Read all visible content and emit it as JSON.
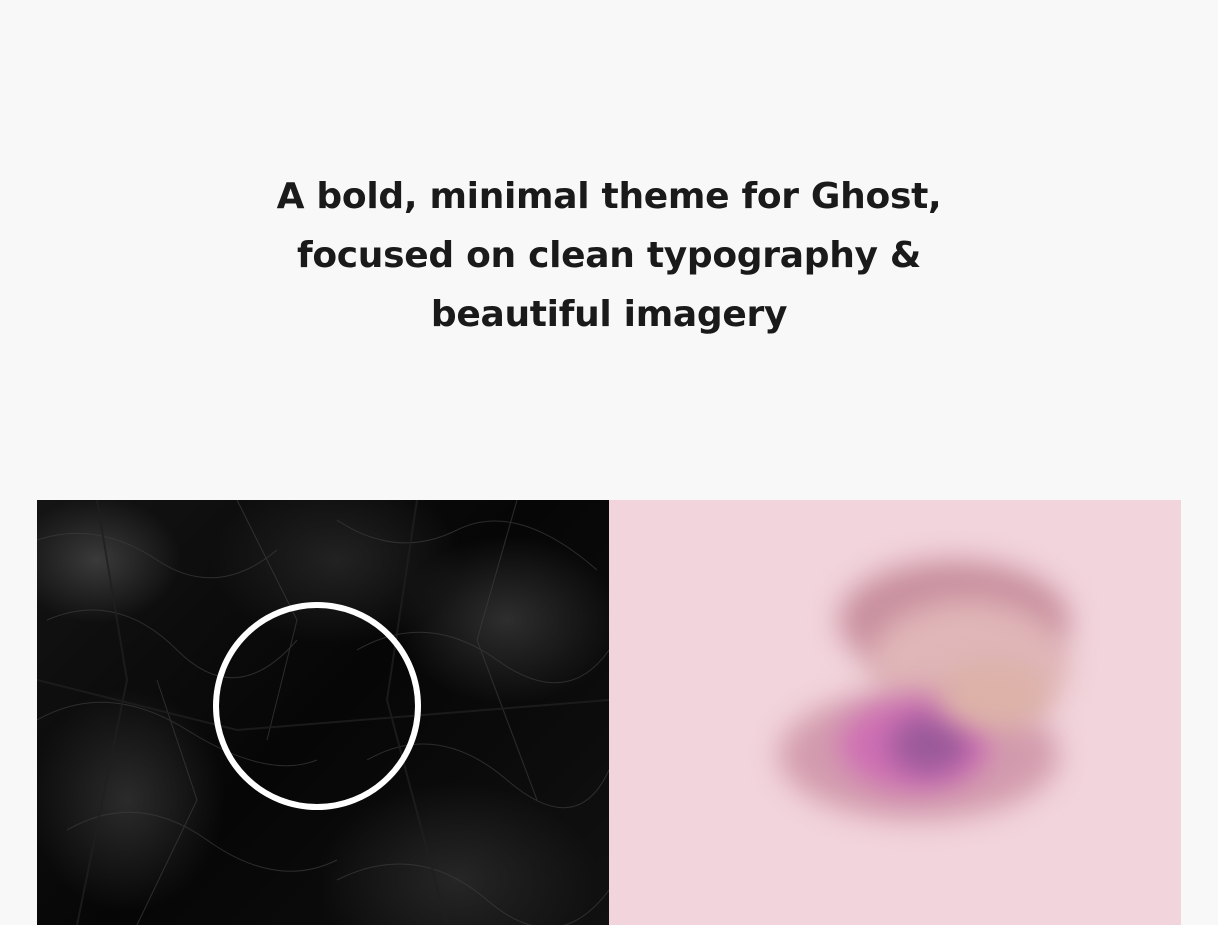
{
  "hero": {
    "tagline_line1": "A bold, minimal theme for Ghost,",
    "tagline_line2": "focused on clean typography &",
    "tagline_line3": "beautiful imagery"
  },
  "feed": {
    "cards": [
      {
        "image": "dark-textured-leaves-with-white-ring"
      },
      {
        "image": "blurred-pink-flower-on-pink-background"
      }
    ]
  },
  "colors": {
    "background": "#f8f8f8",
    "text": "#1a1a1a",
    "pink_card": "#f2d4dc"
  }
}
